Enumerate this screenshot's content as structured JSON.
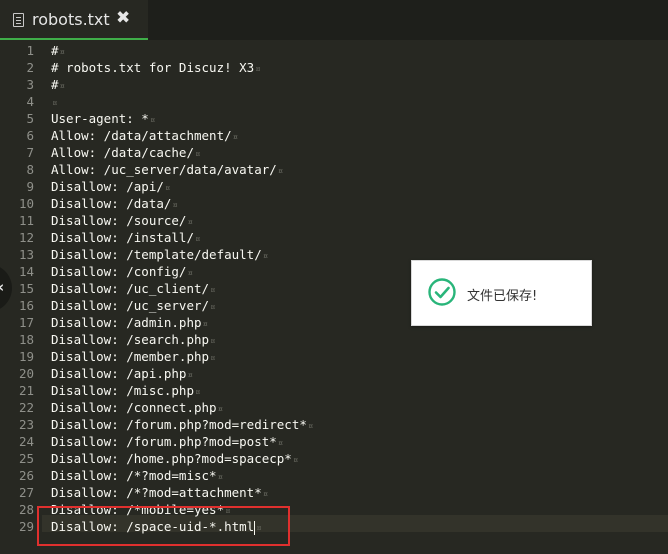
{
  "tab": {
    "title": "robots.txt",
    "close_glyph": "✖",
    "icon": "file-icon"
  },
  "colors": {
    "accent": "#3fae49",
    "background": "#272822",
    "gutter_text": "#8f908a",
    "code_text": "#f8f8f2",
    "highlight_box": "#e0302e"
  },
  "editor": {
    "eol_marker": "¤",
    "lines": [
      {
        "num": "1",
        "text": "#"
      },
      {
        "num": "2",
        "text": "# robots.txt for Discuz! X3"
      },
      {
        "num": "3",
        "text": "#"
      },
      {
        "num": "4",
        "text": ""
      },
      {
        "num": "5",
        "text": "User-agent: *"
      },
      {
        "num": "6",
        "text": "Allow: /data/attachment/"
      },
      {
        "num": "7",
        "text": "Allow: /data/cache/"
      },
      {
        "num": "8",
        "text": "Allow: /uc_server/data/avatar/"
      },
      {
        "num": "9",
        "text": "Disallow: /api/"
      },
      {
        "num": "10",
        "text": "Disallow: /data/"
      },
      {
        "num": "11",
        "text": "Disallow: /source/"
      },
      {
        "num": "12",
        "text": "Disallow: /install/"
      },
      {
        "num": "13",
        "text": "Disallow: /template/default/"
      },
      {
        "num": "14",
        "text": "Disallow: /config/"
      },
      {
        "num": "15",
        "text": "Disallow: /uc_client/"
      },
      {
        "num": "16",
        "text": "Disallow: /uc_server/"
      },
      {
        "num": "17",
        "text": "Disallow: /admin.php"
      },
      {
        "num": "18",
        "text": "Disallow: /search.php"
      },
      {
        "num": "19",
        "text": "Disallow: /member.php"
      },
      {
        "num": "20",
        "text": "Disallow: /api.php"
      },
      {
        "num": "21",
        "text": "Disallow: /misc.php"
      },
      {
        "num": "22",
        "text": "Disallow: /connect.php"
      },
      {
        "num": "23",
        "text": "Disallow: /forum.php?mod=redirect*"
      },
      {
        "num": "24",
        "text": "Disallow: /forum.php?mod=post*"
      },
      {
        "num": "25",
        "text": "Disallow: /home.php?mod=spacecp*"
      },
      {
        "num": "26",
        "text": "Disallow: /*?mod=misc*"
      },
      {
        "num": "27",
        "text": "Disallow: /*?mod=attachment*"
      },
      {
        "num": "28",
        "text": "Disallow: /*mobile=yes*"
      },
      {
        "num": "29",
        "text": "Disallow: /space-uid-*.html"
      }
    ]
  },
  "toast": {
    "message": "文件已保存!",
    "icon": "check-circle-icon",
    "icon_color": "#29b57a"
  },
  "sidebar_toggle": {
    "glyph": "‹",
    "icon": "chevron-left-icon"
  }
}
